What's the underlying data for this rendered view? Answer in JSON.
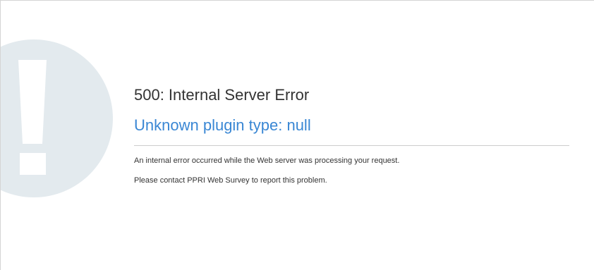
{
  "error": {
    "code_title": "500: Internal Server Error",
    "subtitle": "Unknown plugin type: null",
    "message_lines": [
      "An internal error occurred while the Web server was processing your request.",
      "Please contact PPRI Web Survey to report this problem."
    ]
  },
  "icons": {
    "graphic": "exclamation-circle-icon"
  },
  "colors": {
    "subtitle": "#3a87d4",
    "graphic_fill": "#e3eaee",
    "text": "#333333",
    "divider": "#cccccc"
  }
}
